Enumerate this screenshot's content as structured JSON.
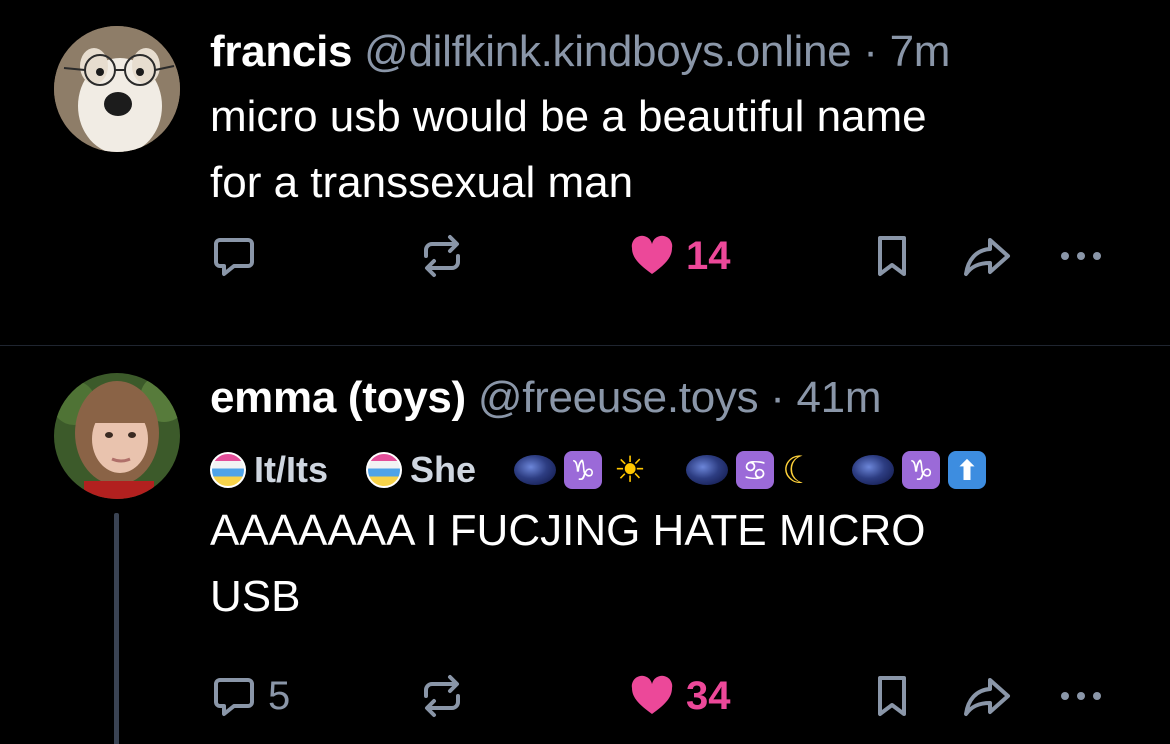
{
  "posts": [
    {
      "author": {
        "name": "francis",
        "handle": "@dilfkink.kindboys.online",
        "avatar_icon": "dog-with-glasses-avatar"
      },
      "separator": "·",
      "time": "7m",
      "text_lines": [
        "micro usb would be a beautiful name",
        "for a transsexual man"
      ],
      "actions": {
        "reply_count": "",
        "repost_count": "",
        "like_count": "14",
        "liked": true
      }
    },
    {
      "author": {
        "name": "emma (toys)",
        "handle": "@freeuse.toys",
        "avatar_icon": "person-avatar"
      },
      "separator": "·",
      "time": "41m",
      "labels": {
        "pronoun_1": "It/Its",
        "pronoun_2": "She",
        "signs": [
          "galaxy",
          "capricorn",
          "sun",
          "galaxy",
          "cancer",
          "moon",
          "galaxy",
          "capricorn",
          "up-arrow"
        ]
      },
      "text_lines": [
        "AAAAAAA I FUCJING HATE MICRO",
        "USB"
      ],
      "actions": {
        "reply_count": "5",
        "repost_count": "",
        "like_count": "34",
        "liked": true
      }
    }
  ],
  "colors": {
    "background": "#000000",
    "muted": "#8a96a8",
    "like": "#ec4899",
    "divider": "#1f2530"
  }
}
